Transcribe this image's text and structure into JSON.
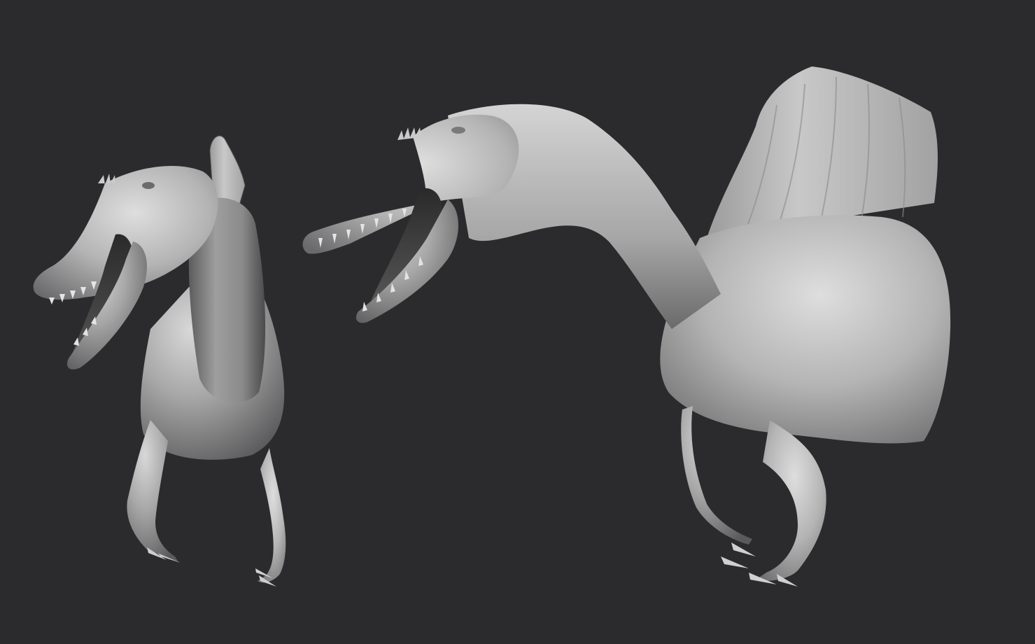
{
  "viewport": {
    "background_color": "#2b2b2d"
  },
  "model": {
    "material": "clay",
    "base_color": "#9a9a9a",
    "light_color": "#dcdcdc",
    "shadow_color": "#3c3c3e"
  },
  "views": [
    {
      "name": "three-quarter-front"
    },
    {
      "name": "side"
    }
  ]
}
